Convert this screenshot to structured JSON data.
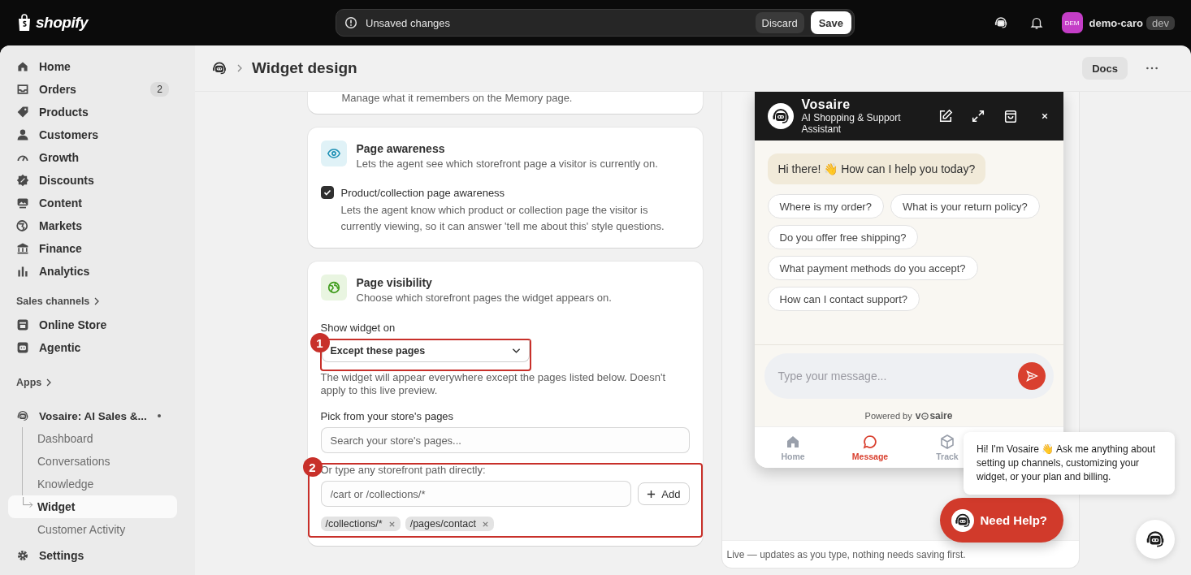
{
  "topbar": {
    "brand": "shopify",
    "notice": "Unsaved changes",
    "discard": "Discard",
    "save": "Save",
    "avatar": "DEM",
    "store": "demo-caro",
    "env": "dev"
  },
  "sidebar": {
    "main": [
      {
        "label": "Home"
      },
      {
        "label": "Orders",
        "count": "2"
      },
      {
        "label": "Products"
      },
      {
        "label": "Customers"
      },
      {
        "label": "Growth"
      },
      {
        "label": "Discounts"
      },
      {
        "label": "Content"
      },
      {
        "label": "Markets"
      },
      {
        "label": "Finance"
      },
      {
        "label": "Analytics"
      }
    ],
    "channels_title": "Sales channels",
    "channels": [
      {
        "label": "Online Store"
      },
      {
        "label": "Agentic"
      }
    ],
    "apps_title": "Apps",
    "app": {
      "name": "Vosaire: AI Sales &...",
      "children": [
        {
          "label": "Dashboard",
          "selected": false
        },
        {
          "label": "Conversations",
          "selected": false
        },
        {
          "label": "Knowledge",
          "selected": false
        },
        {
          "label": "Widget",
          "selected": true
        },
        {
          "label": "Customer Activity",
          "selected": false
        }
      ]
    },
    "settings": "Settings"
  },
  "header": {
    "title": "Widget design",
    "docs": "Docs"
  },
  "memory_note": "Manage what it remembers on the Memory page.",
  "awareness": {
    "title": "Page awareness",
    "description": "Lets the agent see which storefront page a visitor is currently on.",
    "option": {
      "label": "Product/collection page awareness",
      "checked": true,
      "help": "Lets the agent know which product or collection page the visitor is currently viewing, so it can answer 'tell me about this' style questions."
    }
  },
  "visibility": {
    "title": "Page visibility",
    "description": "Choose which storefront pages the widget appears on.",
    "show_label": "Show widget on",
    "mode": "Except these pages",
    "mode_help": "The widget will appear everywhere except the pages listed below. Doesn't apply to this live preview.",
    "pick_label": "Pick from your store's pages",
    "search_placeholder": "Search your store's pages...",
    "path_label": "Or type any storefront path directly:",
    "path_placeholder": "/cart or /collections/*",
    "add": "Add",
    "paths": [
      "/collections/*",
      "/pages/contact"
    ]
  },
  "annotations": [
    "1",
    "2"
  ],
  "preview": {
    "name": "Vosaire",
    "subtitle": "AI Shopping & Support Assistant",
    "greeting": "Hi there! 👋 How can I help you today?",
    "suggestions": [
      "Where is my order?",
      "What is your return policy?",
      "Do you offer free shipping?",
      "What payment methods do you accept?",
      "How can I contact support?"
    ],
    "input_placeholder": "Type your message...",
    "powered_by": "Powered by",
    "brand_start": "v",
    "brand_end": "saire",
    "tabs": [
      {
        "label": "Home",
        "selected": false
      },
      {
        "label": "Message",
        "selected": true
      },
      {
        "label": "Track",
        "selected": false
      }
    ],
    "note": "Live — updates as you type, nothing needs saving first.",
    "launcher": "Need Help?"
  },
  "assistant_tip": "Hi! I'm Vosaire 👋  Ask me anything about setting up channels, customizing your widget, or your plan and billing."
}
